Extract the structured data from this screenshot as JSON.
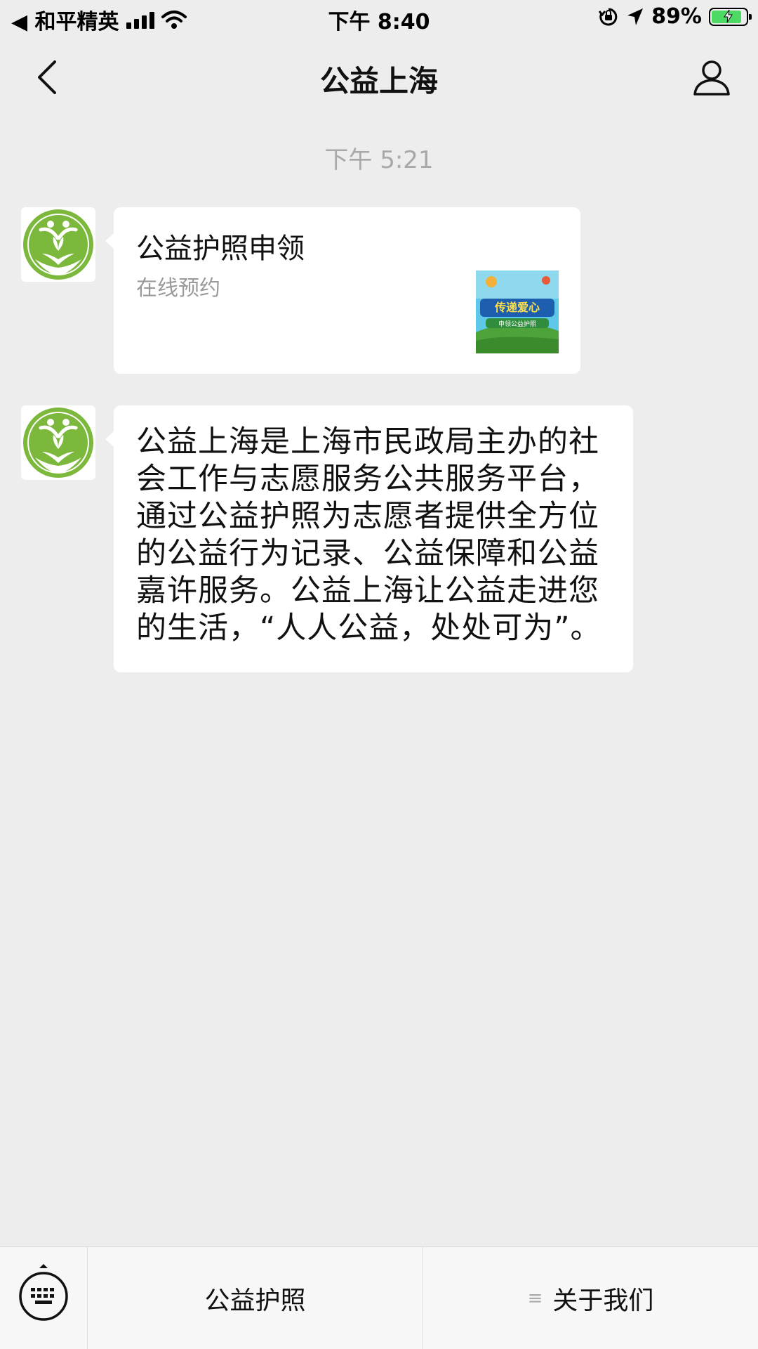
{
  "status_bar": {
    "back_app": "◀ 和平精英",
    "time": "下午 8:40",
    "battery": "89%",
    "battery_level": 0.89
  },
  "nav": {
    "title": "公益上海"
  },
  "chat": {
    "timestamp": "下午 5:21",
    "card": {
      "title": "公益护照申领",
      "subtitle": "在线预约",
      "thumb_text_1": "传递爱心",
      "thumb_text_2": "申领公益护照"
    },
    "text_message": {
      "lines": [
        "公益上海是上海市民政局主办的社",
        "会工作与志愿服务公共服务平台，",
        "通过公益护照为志愿者提供全方位",
        "的公益行为记录、公益保障和公益",
        "嘉许服务。公益上海让公益走进您",
        "的生活，“人人公益，处处可为”。"
      ]
    }
  },
  "bottom_menu": {
    "item_1": "公益护照",
    "item_2": "关于我们",
    "item_2_prefix": "≡"
  },
  "colors": {
    "background": "#ededed",
    "bubble": "#ffffff",
    "logo_green": "#7cb83c",
    "battery_green": "#4cd964"
  }
}
